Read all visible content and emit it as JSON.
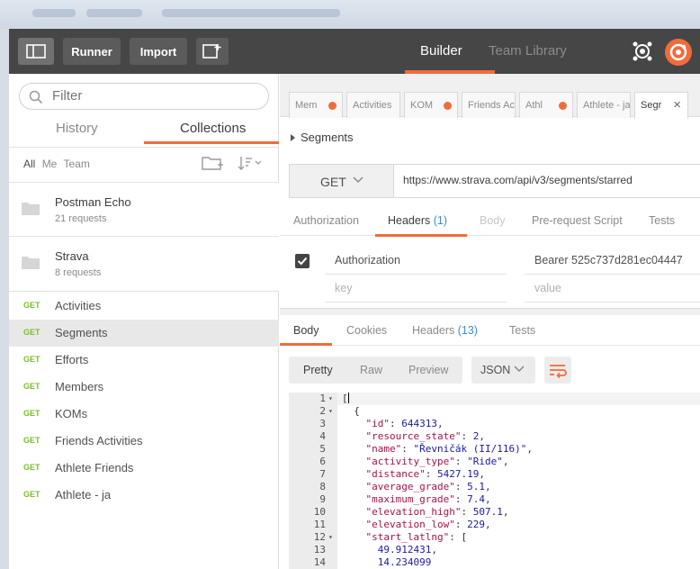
{
  "topbar": {
    "runner_label": "Runner",
    "import_label": "Import",
    "builder_tab": "Builder",
    "team_library_tab": "Team Library"
  },
  "sidebar": {
    "search_placeholder": "Filter",
    "tab_history": "History",
    "tab_collections": "Collections",
    "filter_all": "All",
    "filter_me": "Me",
    "filter_team": "Team",
    "collections": [
      {
        "name": "Postman Echo",
        "count": "21 requests"
      },
      {
        "name": "Strava",
        "count": "8 requests"
      }
    ],
    "requests": [
      {
        "method": "GET",
        "name": "Activities"
      },
      {
        "method": "GET",
        "name": "Segments"
      },
      {
        "method": "GET",
        "name": "Efforts"
      },
      {
        "method": "GET",
        "name": "Members"
      },
      {
        "method": "GET",
        "name": "KOMs"
      },
      {
        "method": "GET",
        "name": "Friends Activities"
      },
      {
        "method": "GET",
        "name": "Athlete Friends"
      },
      {
        "method": "GET",
        "name": "Athlete - ja"
      }
    ]
  },
  "request_tabs": [
    {
      "label": "Mem"
    },
    {
      "label": "Activities"
    },
    {
      "label": "KOM"
    },
    {
      "label": "Friends Ac"
    },
    {
      "label": "Athl"
    },
    {
      "label": "Athlete - ja"
    },
    {
      "label": "Segr"
    }
  ],
  "request": {
    "breadcrumb": "Segments",
    "method": "GET",
    "url": "https://www.strava.com/api/v3/segments/starred",
    "tabs": {
      "authorization": "Authorization",
      "headers": "Headers",
      "headers_count": "(1)",
      "body": "Body",
      "prerequest": "Pre-request Script",
      "tests": "Tests"
    },
    "headers": [
      {
        "key": "Authorization",
        "value": "Bearer 525c737d281ec04447"
      }
    ],
    "key_placeholder": "key",
    "value_placeholder": "value"
  },
  "response": {
    "tabs": {
      "body": "Body",
      "cookies": "Cookies",
      "headers": "Headers",
      "headers_count": "(13)",
      "tests": "Tests"
    },
    "format": {
      "pretty": "Pretty",
      "raw": "Raw",
      "preview": "Preview",
      "language": "JSON"
    },
    "code_lines": [
      {
        "n": "1",
        "fold": true
      },
      {
        "n": "2",
        "fold": true
      },
      {
        "n": "3",
        "fold": false
      },
      {
        "n": "4",
        "fold": false
      },
      {
        "n": "5",
        "fold": false
      },
      {
        "n": "6",
        "fold": false
      },
      {
        "n": "7",
        "fold": false
      },
      {
        "n": "8",
        "fold": false
      },
      {
        "n": "9",
        "fold": false
      },
      {
        "n": "10",
        "fold": false
      },
      {
        "n": "11",
        "fold": false
      },
      {
        "n": "12",
        "fold": true
      },
      {
        "n": "13",
        "fold": false
      },
      {
        "n": "14",
        "fold": false
      }
    ],
    "json": {
      "l1": "[",
      "l2": "{",
      "id_key": "\"id\"",
      "id_val": "644313",
      "rs_key": "\"resource_state\"",
      "rs_val": "2",
      "name_key": "\"name\"",
      "name_val": "\"Řevničák (II/116)\"",
      "at_key": "\"activity_type\"",
      "at_val": "\"Ride\"",
      "dist_key": "\"distance\"",
      "dist_val": "5427.19",
      "ag_key": "\"average_grade\"",
      "ag_val": "5.1",
      "mg_key": "\"maximum_grade\"",
      "mg_val": "7.4",
      "eh_key": "\"elevation_high\"",
      "eh_val": "507.1",
      "el_key": "\"elevation_low\"",
      "el_val": "229",
      "sl_key": "\"start_latlng\"",
      "sl_open": "[",
      "lat": "49.912431",
      "lng": "14.234099"
    }
  }
}
